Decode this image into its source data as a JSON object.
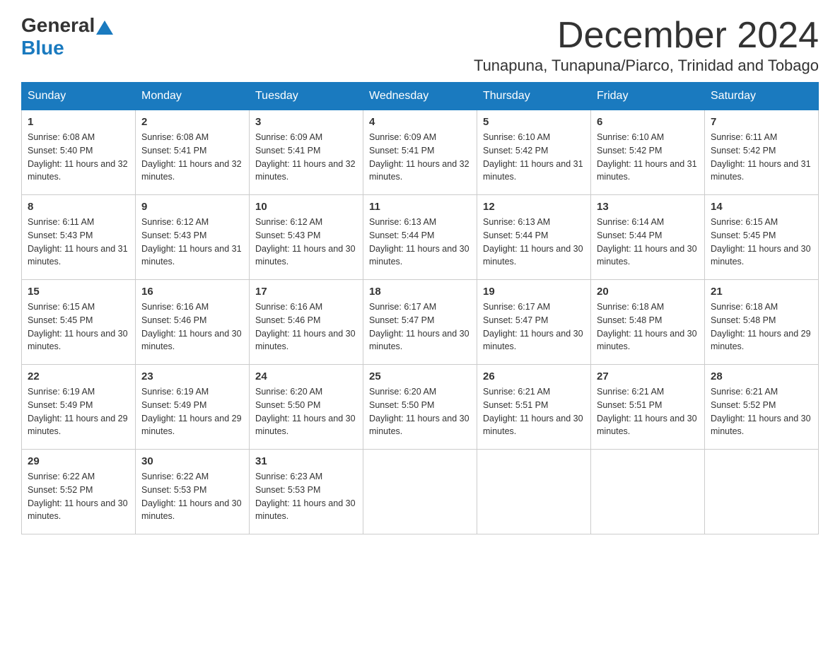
{
  "header": {
    "logo_text_general": "General",
    "logo_text_blue": "Blue",
    "month_title": "December 2024",
    "location": "Tunapuna, Tunapuna/Piarco, Trinidad and Tobago"
  },
  "days_of_week": [
    "Sunday",
    "Monday",
    "Tuesday",
    "Wednesday",
    "Thursday",
    "Friday",
    "Saturday"
  ],
  "weeks": [
    [
      {
        "day": "1",
        "sunrise": "6:08 AM",
        "sunset": "5:40 PM",
        "daylight": "11 hours and 32 minutes."
      },
      {
        "day": "2",
        "sunrise": "6:08 AM",
        "sunset": "5:41 PM",
        "daylight": "11 hours and 32 minutes."
      },
      {
        "day": "3",
        "sunrise": "6:09 AM",
        "sunset": "5:41 PM",
        "daylight": "11 hours and 32 minutes."
      },
      {
        "day": "4",
        "sunrise": "6:09 AM",
        "sunset": "5:41 PM",
        "daylight": "11 hours and 32 minutes."
      },
      {
        "day": "5",
        "sunrise": "6:10 AM",
        "sunset": "5:42 PM",
        "daylight": "11 hours and 31 minutes."
      },
      {
        "day": "6",
        "sunrise": "6:10 AM",
        "sunset": "5:42 PM",
        "daylight": "11 hours and 31 minutes."
      },
      {
        "day": "7",
        "sunrise": "6:11 AM",
        "sunset": "5:42 PM",
        "daylight": "11 hours and 31 minutes."
      }
    ],
    [
      {
        "day": "8",
        "sunrise": "6:11 AM",
        "sunset": "5:43 PM",
        "daylight": "11 hours and 31 minutes."
      },
      {
        "day": "9",
        "sunrise": "6:12 AM",
        "sunset": "5:43 PM",
        "daylight": "11 hours and 31 minutes."
      },
      {
        "day": "10",
        "sunrise": "6:12 AM",
        "sunset": "5:43 PM",
        "daylight": "11 hours and 30 minutes."
      },
      {
        "day": "11",
        "sunrise": "6:13 AM",
        "sunset": "5:44 PM",
        "daylight": "11 hours and 30 minutes."
      },
      {
        "day": "12",
        "sunrise": "6:13 AM",
        "sunset": "5:44 PM",
        "daylight": "11 hours and 30 minutes."
      },
      {
        "day": "13",
        "sunrise": "6:14 AM",
        "sunset": "5:44 PM",
        "daylight": "11 hours and 30 minutes."
      },
      {
        "day": "14",
        "sunrise": "6:15 AM",
        "sunset": "5:45 PM",
        "daylight": "11 hours and 30 minutes."
      }
    ],
    [
      {
        "day": "15",
        "sunrise": "6:15 AM",
        "sunset": "5:45 PM",
        "daylight": "11 hours and 30 minutes."
      },
      {
        "day": "16",
        "sunrise": "6:16 AM",
        "sunset": "5:46 PM",
        "daylight": "11 hours and 30 minutes."
      },
      {
        "day": "17",
        "sunrise": "6:16 AM",
        "sunset": "5:46 PM",
        "daylight": "11 hours and 30 minutes."
      },
      {
        "day": "18",
        "sunrise": "6:17 AM",
        "sunset": "5:47 PM",
        "daylight": "11 hours and 30 minutes."
      },
      {
        "day": "19",
        "sunrise": "6:17 AM",
        "sunset": "5:47 PM",
        "daylight": "11 hours and 30 minutes."
      },
      {
        "day": "20",
        "sunrise": "6:18 AM",
        "sunset": "5:48 PM",
        "daylight": "11 hours and 30 minutes."
      },
      {
        "day": "21",
        "sunrise": "6:18 AM",
        "sunset": "5:48 PM",
        "daylight": "11 hours and 29 minutes."
      }
    ],
    [
      {
        "day": "22",
        "sunrise": "6:19 AM",
        "sunset": "5:49 PM",
        "daylight": "11 hours and 29 minutes."
      },
      {
        "day": "23",
        "sunrise": "6:19 AM",
        "sunset": "5:49 PM",
        "daylight": "11 hours and 29 minutes."
      },
      {
        "day": "24",
        "sunrise": "6:20 AM",
        "sunset": "5:50 PM",
        "daylight": "11 hours and 30 minutes."
      },
      {
        "day": "25",
        "sunrise": "6:20 AM",
        "sunset": "5:50 PM",
        "daylight": "11 hours and 30 minutes."
      },
      {
        "day": "26",
        "sunrise": "6:21 AM",
        "sunset": "5:51 PM",
        "daylight": "11 hours and 30 minutes."
      },
      {
        "day": "27",
        "sunrise": "6:21 AM",
        "sunset": "5:51 PM",
        "daylight": "11 hours and 30 minutes."
      },
      {
        "day": "28",
        "sunrise": "6:21 AM",
        "sunset": "5:52 PM",
        "daylight": "11 hours and 30 minutes."
      }
    ],
    [
      {
        "day": "29",
        "sunrise": "6:22 AM",
        "sunset": "5:52 PM",
        "daylight": "11 hours and 30 minutes."
      },
      {
        "day": "30",
        "sunrise": "6:22 AM",
        "sunset": "5:53 PM",
        "daylight": "11 hours and 30 minutes."
      },
      {
        "day": "31",
        "sunrise": "6:23 AM",
        "sunset": "5:53 PM",
        "daylight": "11 hours and 30 minutes."
      },
      null,
      null,
      null,
      null
    ]
  ]
}
